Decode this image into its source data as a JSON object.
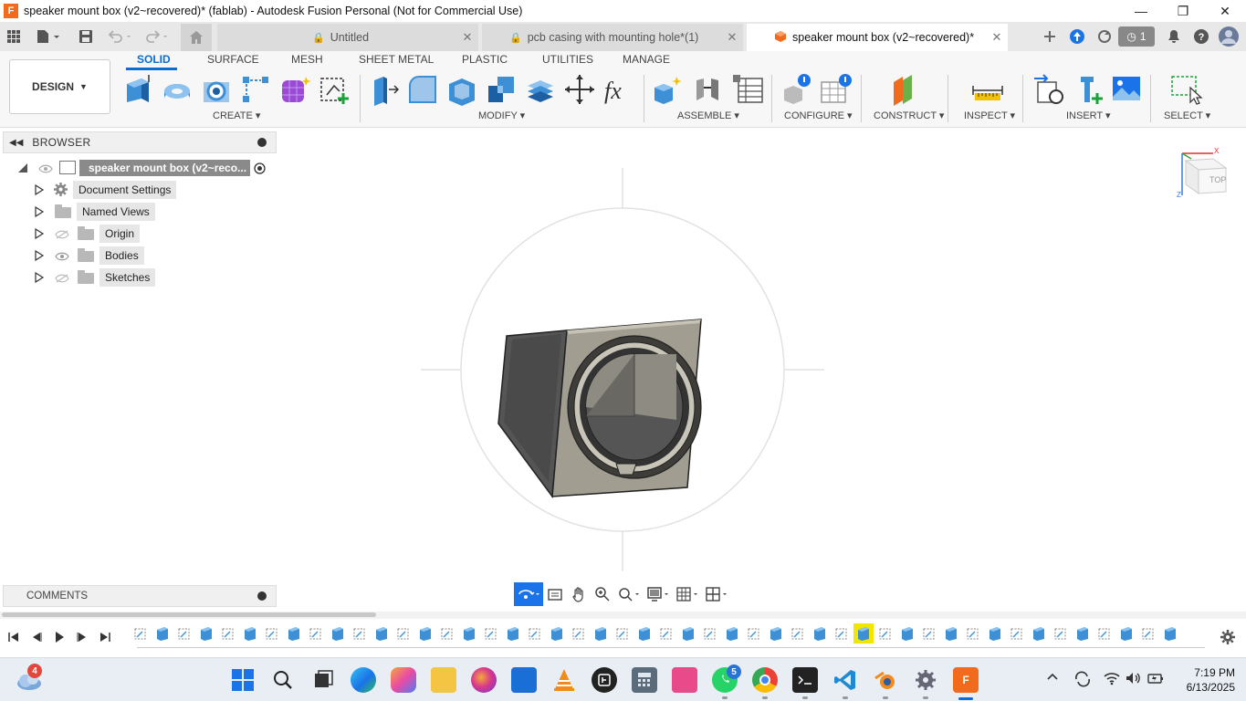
{
  "window": {
    "title": "speaker mount box (v2~recovered)* (fablab) - Autodesk Fusion Personal (Not for Commercial Use)",
    "logo_text": "F",
    "controls": {
      "minimize": "—",
      "maximize": "❐",
      "close": "✕"
    }
  },
  "tabs": [
    {
      "label": "Untitled",
      "active": false
    },
    {
      "label": "pcb casing with mounting hole*(1)",
      "active": false
    },
    {
      "label": "speaker mount box (v2~recovered)*",
      "active": true
    }
  ],
  "header_icons": {
    "job_status_count": "1"
  },
  "workspace": {
    "label": "DESIGN"
  },
  "workspace_tabs": [
    "SOLID",
    "SURFACE",
    "MESH",
    "SHEET METAL",
    "PLASTIC",
    "UTILITIES",
    "MANAGE"
  ],
  "tool_groups": {
    "create": "CREATE",
    "modify": "MODIFY",
    "assemble": "ASSEMBLE",
    "configure": "CONFIGURE",
    "construct": "CONSTRUCT",
    "inspect": "INSPECT",
    "insert": "INSERT",
    "select": "SELECT"
  },
  "browser": {
    "title": "BROWSER",
    "root": "speaker mount box (v2~reco...",
    "items": [
      {
        "label": "Document Settings",
        "icon": "gear-icon"
      },
      {
        "label": "Named Views",
        "icon": "folder-icon"
      },
      {
        "label": "Origin",
        "icon": "folder-icon",
        "visible": false
      },
      {
        "label": "Bodies",
        "icon": "folder-icon",
        "visible": true
      },
      {
        "label": "Sketches",
        "icon": "folder-icon",
        "visible": false
      }
    ]
  },
  "comments": {
    "label": "COMMENTS"
  },
  "viewcube": {
    "face": "TOP",
    "axis_x": "X",
    "axis_z": "Z"
  },
  "taskbar": {
    "weather_badge": "4",
    "whatsapp_badge": "5",
    "time": "7:19 PM",
    "date": "6/13/2025"
  },
  "colors": {
    "accent": "#0a6cd5",
    "fusion_orange": "#f26b1d",
    "timeline_highlight": "#f2e600"
  }
}
